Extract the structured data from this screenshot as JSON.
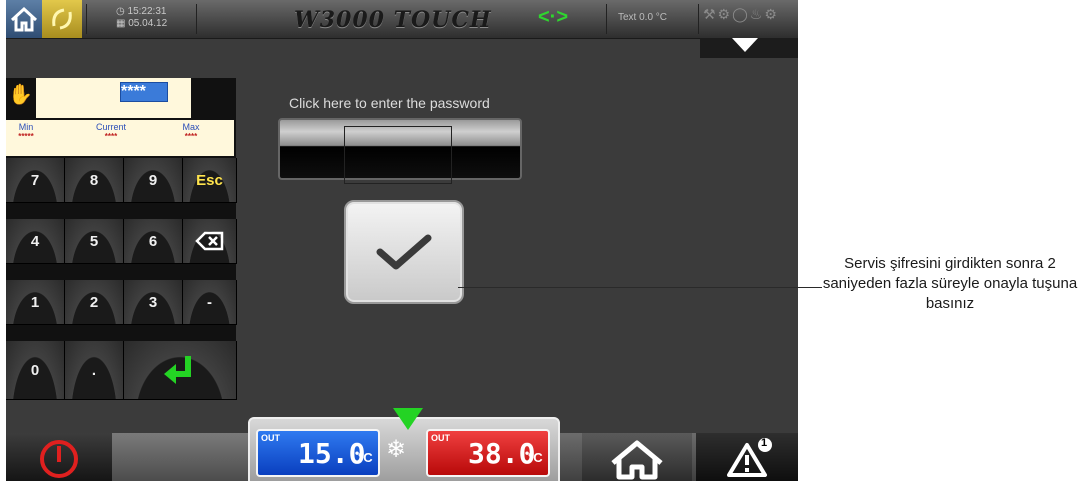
{
  "topbar": {
    "time": "15:22:31",
    "date": "05.04.12",
    "title": "W3000 TOUCH",
    "sync_symbol": "<·>",
    "text_temp": "Text  0.0 °C"
  },
  "keypad": {
    "display_value": "****",
    "min_label": "Min",
    "min_value": "*****",
    "current_label": "Current",
    "current_value": "****",
    "max_label": "Max",
    "max_value": "****",
    "keys": {
      "k7": "7",
      "k8": "8",
      "k9": "9",
      "esc": "Esc",
      "k4": "4",
      "k5": "5",
      "k6": "6",
      "k1": "1",
      "k2": "2",
      "k3": "3",
      "minus": "-",
      "k0": "0",
      "dot": "."
    }
  },
  "password": {
    "prompt": "Click here to enter the password"
  },
  "temperatures": {
    "in_tag": "OUT",
    "in_value": "15.0",
    "in_unit": "°C",
    "out_tag": "OUT",
    "out_value": "38.0",
    "out_unit": "°C"
  },
  "alarm": {
    "count": "1"
  },
  "callout": {
    "text": "Servis şifresini girdikten sonra 2 saniyeden fazla süreyle onayla tuşuna basınız"
  },
  "colors": {
    "accent_green": "#24d324",
    "keypad_highlight": "#3b7bd9",
    "esc_yellow": "#ffe44d",
    "temp_in_blue": "#2f7af0",
    "temp_out_red": "#f04040",
    "power_red": "#e0201f"
  },
  "icons": [
    "home-icon",
    "sync-icon",
    "clock-icon",
    "calendar-icon",
    "arrows-icon",
    "settings-icons",
    "dropdown-arrow-icon",
    "hand-icon",
    "backspace-icon",
    "enter-icon",
    "check-icon",
    "power-icon",
    "snowflake-icon",
    "home-icon",
    "alarm-icon"
  ]
}
